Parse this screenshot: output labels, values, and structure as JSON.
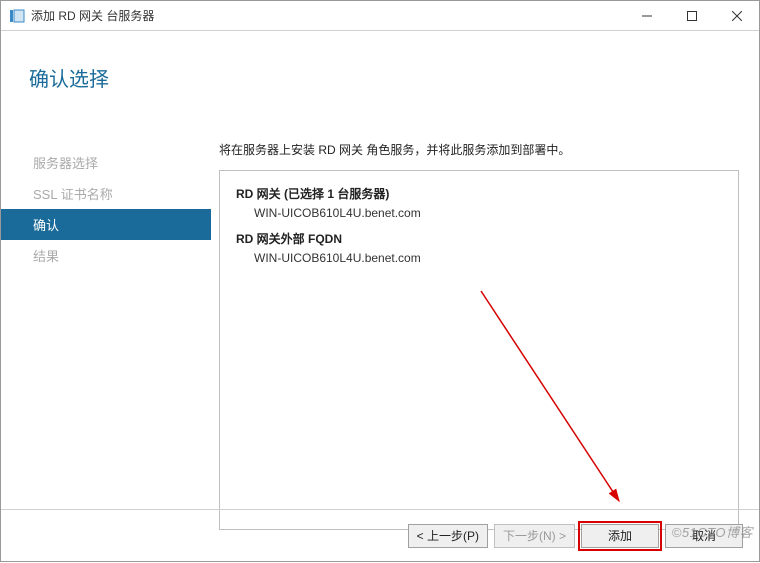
{
  "window": {
    "title": "添加 RD 网关 台服务器"
  },
  "page": {
    "title": "确认选择"
  },
  "steps": {
    "items": [
      {
        "label": "服务器选择",
        "active": false
      },
      {
        "label": "SSL 证书名称",
        "active": false
      },
      {
        "label": "确认",
        "active": true
      },
      {
        "label": "结果",
        "active": false
      }
    ]
  },
  "main": {
    "intro": "将在服务器上安装 RD 网关 角色服务，并将此服务添加到部署中。",
    "sections": [
      {
        "header": "RD 网关  (已选择 1 台服务器)",
        "value": "WIN-UICOB610L4U.benet.com"
      },
      {
        "header": "RD 网关外部 FQDN",
        "value": "WIN-UICOB610L4U.benet.com"
      }
    ]
  },
  "footer": {
    "prev": "< 上一步(P)",
    "next": "下一步(N) >",
    "add": "添加",
    "cancel": "取消"
  },
  "watermark": "©51CTO博客"
}
